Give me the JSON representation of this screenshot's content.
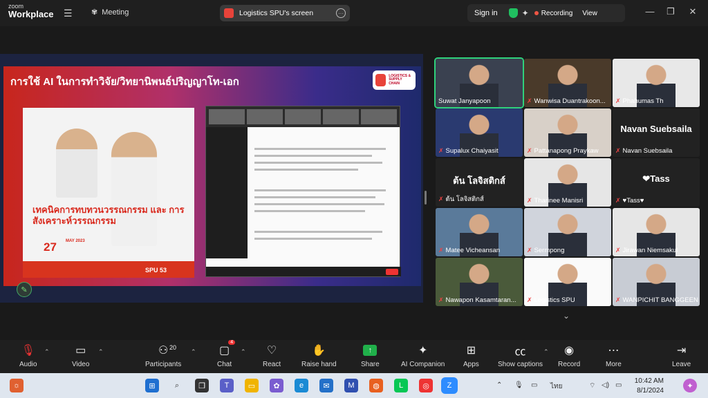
{
  "topbar": {
    "brand_small": "zoom",
    "brand_big": "Workplace",
    "meeting_label": "Meeting",
    "screen_label": "Logistics SPU's screen",
    "sign_in": "Sign in",
    "recording": "Recording",
    "view": "View"
  },
  "slide": {
    "title": "การใช้ AI ในการทำวิจัย/วิทยานิพนธ์ปริญญาโท-เอก",
    "logo_text_1": "LOGISTICS &",
    "logo_text_2": "SUPPLY CHAIN",
    "poster_headline": "เทคนิคการทบทวนวรรณกรรม และ การสังเคราะห์วรรณกรรม",
    "poster_day": "27",
    "poster_month": "MAY 2023",
    "poster_brand": "SPU 53"
  },
  "gallery": {
    "participants": [
      {
        "name": "Suwat Janyapoon",
        "muted": false
      },
      {
        "name": "Wanwisa Duantrakoon...",
        "muted": true
      },
      {
        "name": "Phahumas Th",
        "muted": true
      },
      {
        "name": "Supalux Chaiyasit",
        "muted": true
      },
      {
        "name": "Pattanapong Praykaw",
        "muted": true
      },
      {
        "name": "Navan Suebsaila",
        "muted": true,
        "big": "Navan Suebsaila"
      },
      {
        "name": "ต้น โลจิสติกส์",
        "muted": true,
        "big": "ต้น โลจิสติกส์"
      },
      {
        "name": "Tharinee Manisri",
        "muted": true
      },
      {
        "name": "♥Tass♥",
        "muted": true,
        "big": "❤Tass"
      },
      {
        "name": "Matee Vicheansan",
        "muted": true
      },
      {
        "name": "Sermpong",
        "muted": true
      },
      {
        "name": "Jirawan Niemsakul",
        "muted": true
      },
      {
        "name": "Nawapon Kasamtaran...",
        "muted": true
      },
      {
        "name": "Logistics SPU",
        "muted": true
      },
      {
        "name": "WANPICHIT BANGGEEN",
        "muted": true
      }
    ]
  },
  "controls": {
    "audio": "Audio",
    "video": "Video",
    "participants": "Participants",
    "participants_count": "20",
    "chat": "Chat",
    "chat_badge": "4",
    "react": "React",
    "raise_hand": "Raise hand",
    "share": "Share",
    "ai_companion": "AI Companion",
    "apps": "Apps",
    "show_captions": "Show captions",
    "record": "Record",
    "more": "More",
    "leave": "Leave"
  },
  "taskbar": {
    "time": "10:42 AM",
    "date": "8/1/2024",
    "lang": "ไทย"
  },
  "colors": {
    "accent_green": "#2fd27c",
    "recording_red": "#ee5544",
    "share_green": "#20b04a"
  }
}
